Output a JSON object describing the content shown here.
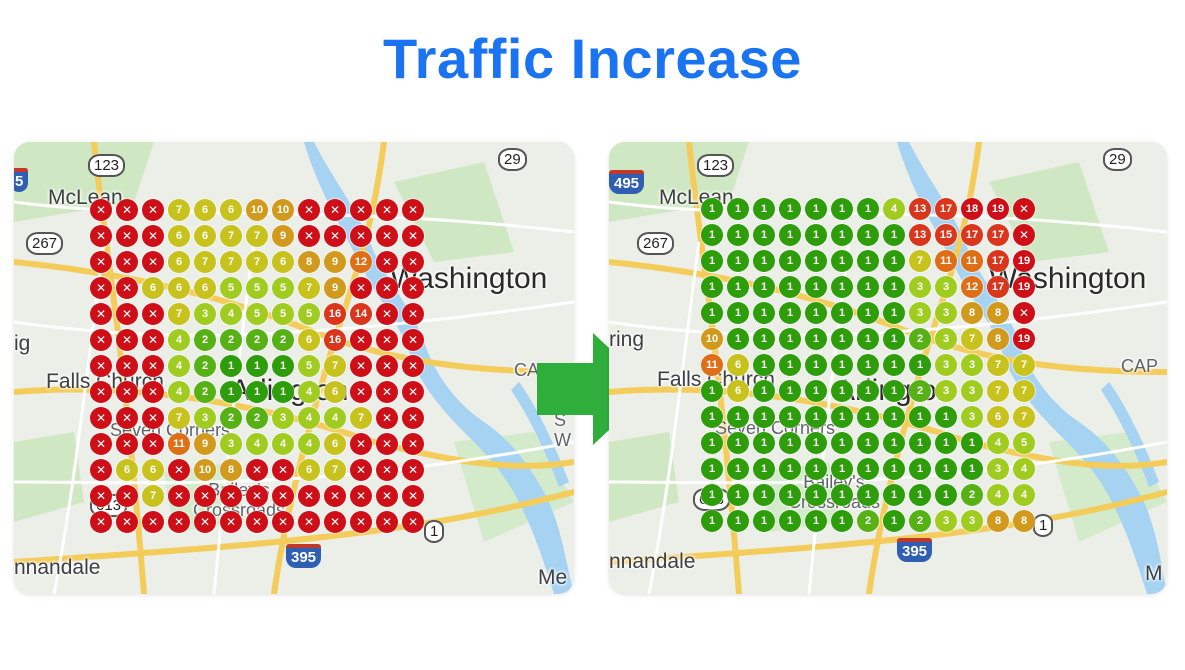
{
  "page": {
    "title": "Traffic Increase"
  },
  "colors": {
    "title": "#1a73f0",
    "arrow": "#2fae3c",
    "rank_1": "#2e9d0a",
    "rank_2": "#56b214",
    "rank_3_5": "#9fcc1f",
    "rank_6_7": "#c8c21d",
    "rank_8_10": "#d29a1c",
    "rank_11_12": "#de6f16",
    "rank_13_17": "#d9361c",
    "rank_18_plus": "#cf0f18",
    "not_ranked": "#cf0f18"
  },
  "maps": {
    "before": {
      "labels": {
        "mclean": "McLean",
        "washington": "Washington",
        "falls_church": "Falls Church",
        "arlington": "Arlington",
        "seven_corners": "Seven Corners",
        "baileys": "Bailey's Crossroads",
        "annandale": "nnandale",
        "edge_left": "ig",
        "edge_right_cap": "CA",
        "edge_right_s": "S",
        "edge_right_w": "W",
        "edge_bottom_right": "Me"
      },
      "shields": {
        "r123": "123",
        "r29": "29",
        "r267": "267",
        "r1": "1",
        "i395": "395",
        "i495": "5",
        "r613": "613"
      },
      "grid": [
        [
          "x",
          "x",
          "x",
          "7",
          "6",
          "6",
          "10",
          "10",
          "x",
          "x",
          "x",
          "x",
          "x"
        ],
        [
          "x",
          "x",
          "x",
          "6",
          "6",
          "7",
          "7",
          "9",
          "x",
          "x",
          "x",
          "x",
          "x"
        ],
        [
          "x",
          "x",
          "x",
          "6",
          "7",
          "7",
          "7",
          "6",
          "8",
          "9",
          "12",
          "x",
          "x"
        ],
        [
          "x",
          "x",
          "6",
          "6",
          "6",
          "5",
          "5",
          "5",
          "7",
          "9",
          "x",
          "x",
          "x"
        ],
        [
          "x",
          "x",
          "x",
          "7",
          "3",
          "4",
          "5",
          "5",
          "5",
          "16",
          "14",
          "x",
          "x"
        ],
        [
          "x",
          "x",
          "x",
          "4",
          "2",
          "2",
          "2",
          "2",
          "6",
          "16",
          "x",
          "x",
          "x"
        ],
        [
          "x",
          "x",
          "x",
          "4",
          "2",
          "1",
          "1",
          "1",
          "5",
          "7",
          "x",
          "x",
          "x"
        ],
        [
          "x",
          "x",
          "x",
          "4",
          "2",
          "1",
          "1",
          "1",
          "4",
          "6",
          "x",
          "x",
          "x"
        ],
        [
          "x",
          "x",
          "x",
          "7",
          "3",
          "2",
          "2",
          "3",
          "4",
          "4",
          "7",
          "x",
          "x"
        ],
        [
          "x",
          "x",
          "x",
          "11",
          "9",
          "3",
          "4",
          "4",
          "4",
          "6",
          "x",
          "x",
          "x"
        ],
        [
          "x",
          "6",
          "6",
          "x",
          "10",
          "8",
          "x",
          "x",
          "6",
          "7",
          "x",
          "x",
          "x"
        ],
        [
          "x",
          "x",
          "7",
          "x",
          "x",
          "x",
          "x",
          "x",
          "x",
          "x",
          "x",
          "x",
          "x"
        ],
        [
          "x",
          "x",
          "x",
          "x",
          "x",
          "x",
          "x",
          "x",
          "x",
          "x",
          "x",
          "x",
          "x"
        ]
      ]
    },
    "after": {
      "labels": {
        "mclean": "McLean",
        "washington": "Washington",
        "falls_church": "Falls Church",
        "arlington": "Arlington",
        "seven_corners": "Seven Corners",
        "baileys": "Bailey's Crossroads",
        "annandale": "nnandale",
        "edge_left": "ring",
        "edge_right_cap": "CAP",
        "edge_bottom_right": "M"
      },
      "shields": {
        "r123": "123",
        "r29": "29",
        "r267": "267",
        "r1": "1",
        "i395": "395",
        "i495": "495",
        "r613": "613"
      },
      "grid": [
        [
          "1",
          "1",
          "1",
          "1",
          "1",
          "1",
          "1",
          "4",
          "13",
          "17",
          "18",
          "19",
          "x"
        ],
        [
          "1",
          "1",
          "1",
          "1",
          "1",
          "1",
          "1",
          "1",
          "13",
          "15",
          "17",
          "17",
          "x"
        ],
        [
          "1",
          "1",
          "1",
          "1",
          "1",
          "1",
          "1",
          "1",
          "7",
          "11",
          "11",
          "17",
          "19"
        ],
        [
          "1",
          "1",
          "1",
          "1",
          "1",
          "1",
          "1",
          "1",
          "3",
          "3",
          "12",
          "17",
          "19"
        ],
        [
          "1",
          "1",
          "1",
          "1",
          "1",
          "1",
          "1",
          "1",
          "3",
          "3",
          "8",
          "8",
          "x"
        ],
        [
          "10",
          "1",
          "1",
          "1",
          "1",
          "1",
          "1",
          "1",
          "2",
          "3",
          "7",
          "8",
          "19"
        ],
        [
          "11",
          "6",
          "1",
          "1",
          "1",
          "1",
          "1",
          "1",
          "1",
          "3",
          "3",
          "7",
          "7"
        ],
        [
          "1",
          "6",
          "1",
          "1",
          "1",
          "1",
          "1",
          "1",
          "2",
          "3",
          "3",
          "7",
          "7"
        ],
        [
          "1",
          "1",
          "1",
          "1",
          "1",
          "1",
          "1",
          "1",
          "1",
          "1",
          "3",
          "6",
          "7"
        ],
        [
          "1",
          "1",
          "1",
          "1",
          "1",
          "1",
          "1",
          "1",
          "1",
          "1",
          "1",
          "4",
          "5"
        ],
        [
          "1",
          "1",
          "1",
          "1",
          "1",
          "1",
          "1",
          "1",
          "1",
          "1",
          "1",
          "3",
          "4"
        ],
        [
          "1",
          "1",
          "1",
          "1",
          "1",
          "1",
          "1",
          "1",
          "1",
          "1",
          "2",
          "4",
          "4"
        ],
        [
          "1",
          "1",
          "1",
          "1",
          "1",
          "1",
          "2",
          "1",
          "2",
          "3",
          "3",
          "8",
          "8"
        ]
      ]
    }
  }
}
